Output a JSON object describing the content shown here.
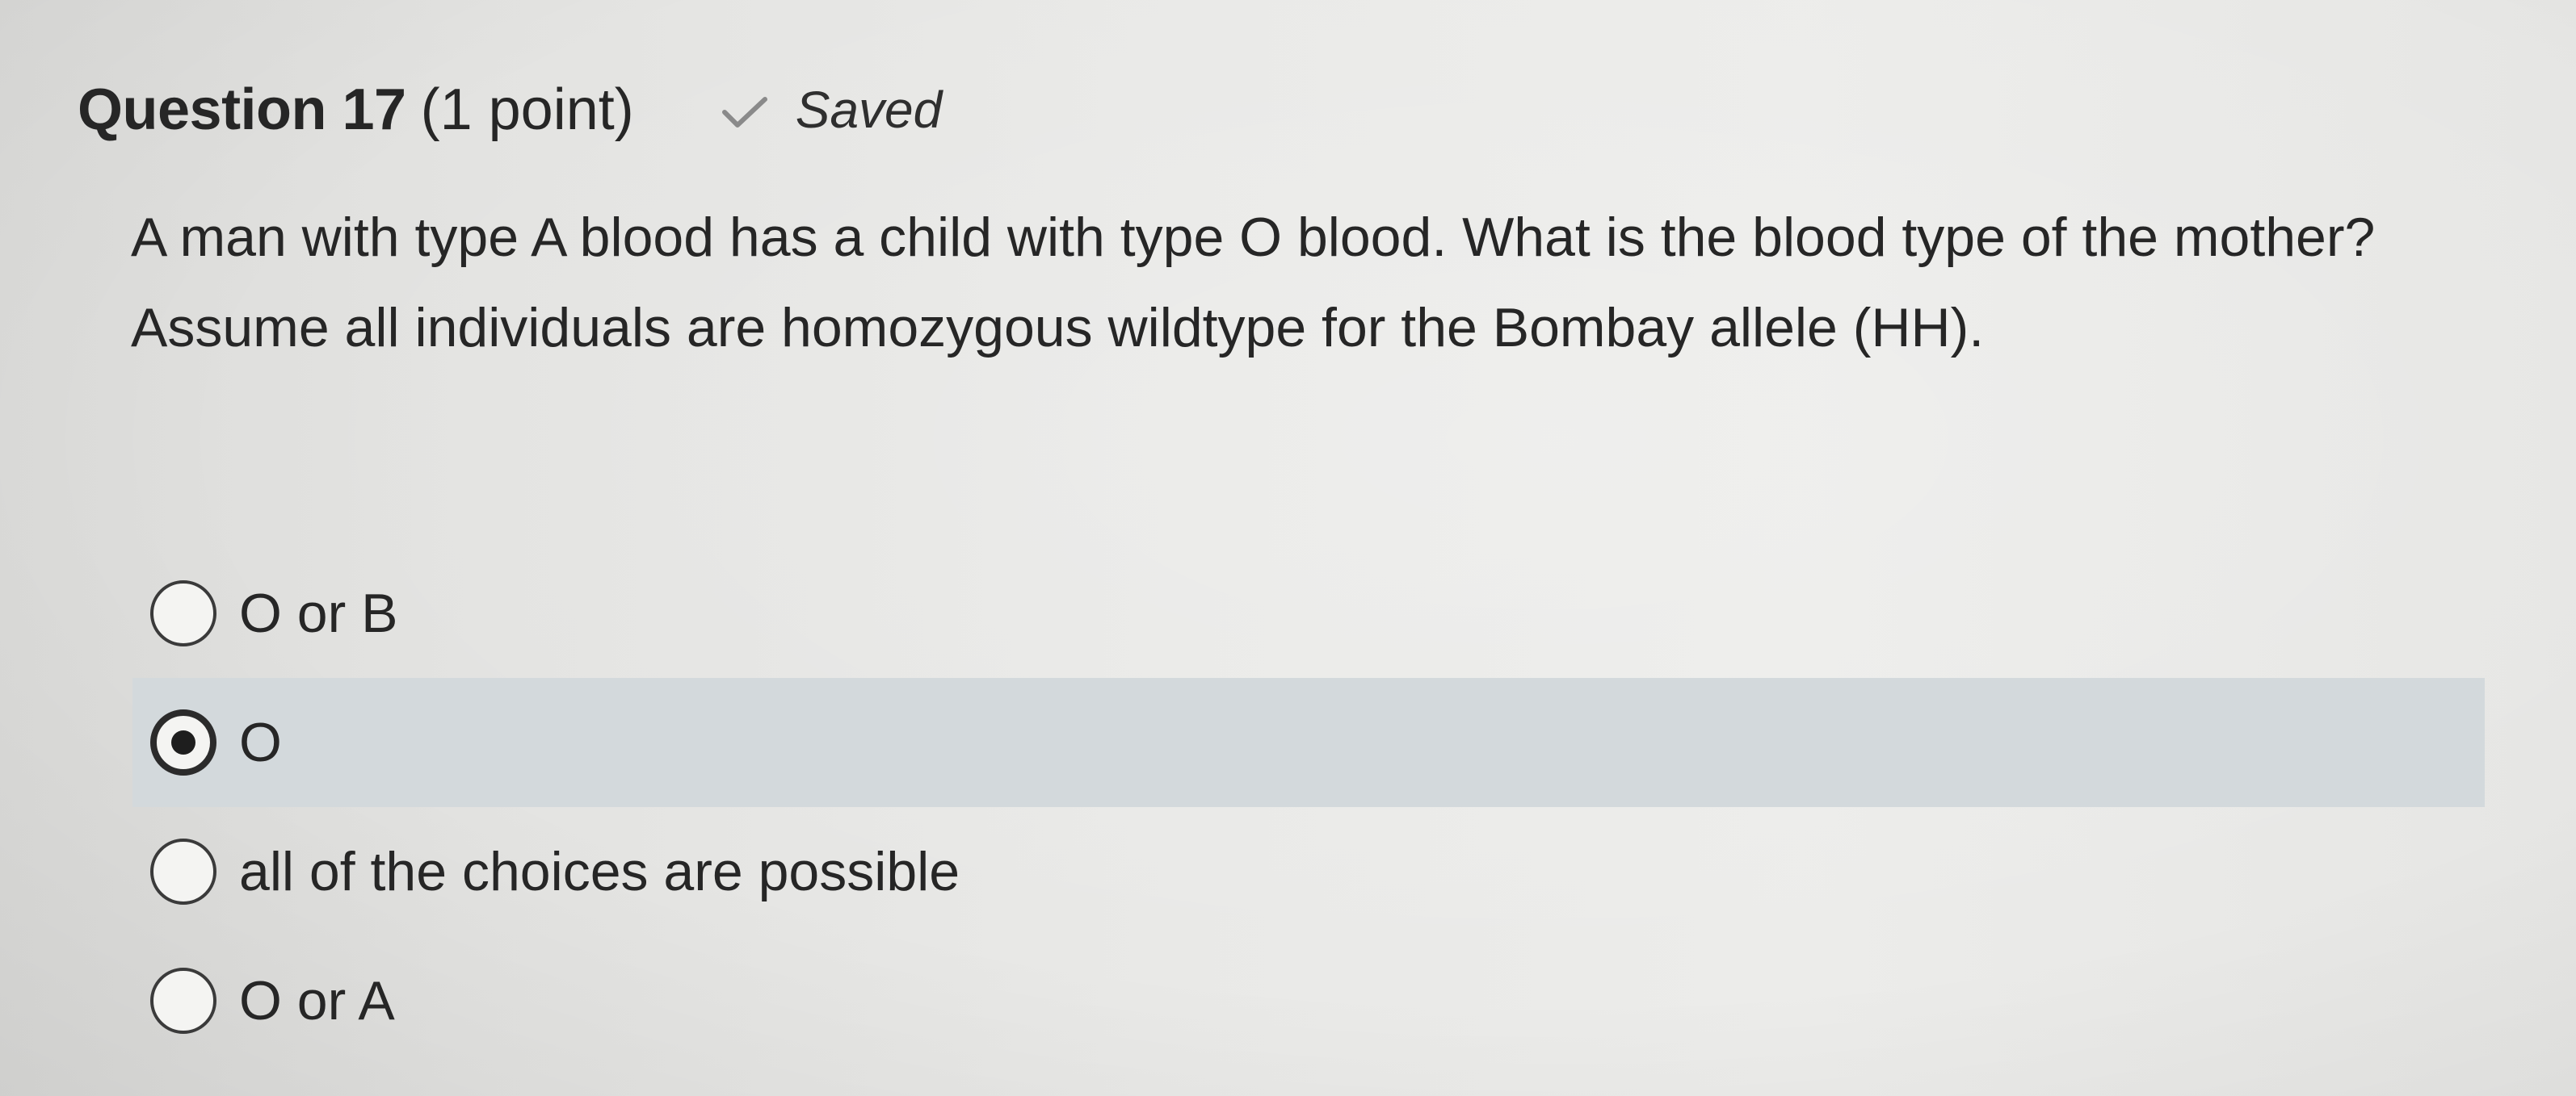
{
  "question": {
    "title": "Question 17",
    "points": "(1 point)",
    "status": "Saved",
    "status_icon": "checkmark-icon",
    "prompt": "A man with type A blood has a child with type O blood. What is the blood type of the mother? Assume all individuals are homozygous wildtype for the Bombay allele (HH)."
  },
  "options": [
    {
      "label": "O or B",
      "selected": false
    },
    {
      "label": "O",
      "selected": true
    },
    {
      "label": "all of the choices are possible",
      "selected": false
    },
    {
      "label": "O or A",
      "selected": false
    }
  ],
  "colors": {
    "selected_row_background": "#d3d9dc",
    "text": "#262626",
    "checkmark": "#8a8a8a"
  }
}
